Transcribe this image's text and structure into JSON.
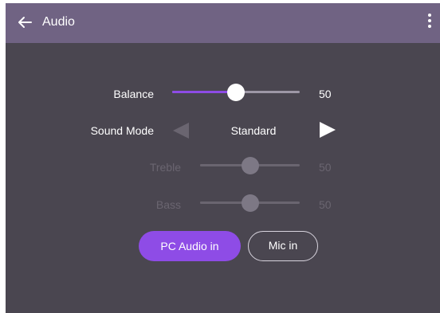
{
  "header": {
    "title": "Audio",
    "back_icon": "arrow-left-icon",
    "menu_icon": "more-vertical-icon"
  },
  "settings": {
    "balance": {
      "label": "Balance",
      "value": "50",
      "level": 0.5,
      "enabled": true
    },
    "sound_mode": {
      "label": "Sound Mode",
      "value": "Standard",
      "prev_icon": "triangle-left-icon",
      "next_icon": "triangle-right-icon",
      "prev_enabled": false,
      "next_enabled": true
    },
    "treble": {
      "label": "Treble",
      "value": "50",
      "level": 0.5,
      "enabled": false
    },
    "bass": {
      "label": "Bass",
      "value": "50",
      "level": 0.5,
      "enabled": false
    }
  },
  "audio_input": {
    "options": [
      {
        "label": "PC Audio in",
        "selected": true
      },
      {
        "label": "Mic in",
        "selected": false
      }
    ]
  },
  "colors": {
    "accent": "#8e4ce6",
    "header_bg": "#706383",
    "panel_bg": "#4a4650",
    "disabled_text": "#6a6570"
  }
}
